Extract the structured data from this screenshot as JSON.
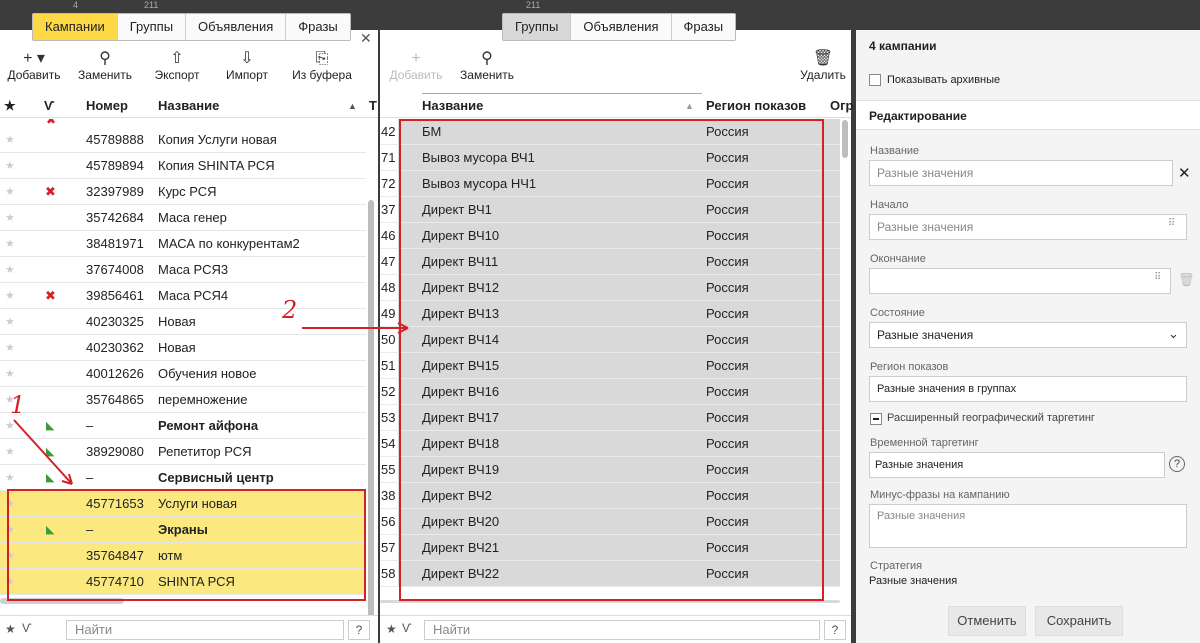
{
  "left": {
    "tab_counts": [
      "4",
      "211"
    ],
    "tabs": [
      "Кампании",
      "Группы",
      "Объявления",
      "Фразы"
    ],
    "toolbar": [
      {
        "icon": "plus-icon",
        "label": "Добавить"
      },
      {
        "icon": "search-icon",
        "label": "Заменить"
      },
      {
        "icon": "export-icon",
        "label": "Экспорт"
      },
      {
        "icon": "import-icon",
        "label": "Импорт"
      },
      {
        "icon": "clipboard-icon",
        "label": "Из буфера"
      }
    ],
    "columns": {
      "star": "★",
      "status": "Ѵ",
      "number": "Номер",
      "name": "Название",
      "more": "Т"
    },
    "rows": [
      {
        "number": "45789888",
        "name": "Копия Услуги новая",
        "status": "",
        "bold": false,
        "hl": false
      },
      {
        "number": "45789894",
        "name": "Копия SHINTA РСЯ",
        "status": "",
        "bold": false,
        "hl": false
      },
      {
        "number": "32397989",
        "name": "Курс РСЯ",
        "status": "error",
        "bold": false,
        "hl": false
      },
      {
        "number": "35742684",
        "name": "Маса генер",
        "status": "",
        "bold": false,
        "hl": false
      },
      {
        "number": "38481971",
        "name": "МАСА по конкурентам2",
        "status": "",
        "bold": false,
        "hl": false
      },
      {
        "number": "37674008",
        "name": "Маса РСЯ3",
        "status": "",
        "bold": false,
        "hl": false
      },
      {
        "number": "39856461",
        "name": "Маса РСЯ4",
        "status": "error",
        "bold": false,
        "hl": false
      },
      {
        "number": "40230325",
        "name": "Новая",
        "status": "",
        "bold": false,
        "hl": false
      },
      {
        "number": "40230362",
        "name": "Новая",
        "status": "",
        "bold": false,
        "hl": false
      },
      {
        "number": "40012626",
        "name": "Обучения новое",
        "status": "",
        "bold": false,
        "hl": false
      },
      {
        "number": "35764865",
        "name": "перемножение",
        "status": "",
        "bold": false,
        "hl": false
      },
      {
        "number": "–",
        "name": "Ремонт айфона",
        "status": "green",
        "bold": true,
        "hl": false
      },
      {
        "number": "38929080",
        "name": "Репетитор РСЯ",
        "status": "green",
        "bold": false,
        "hl": false
      },
      {
        "number": "–",
        "name": "Сервисный центр",
        "status": "green",
        "bold": true,
        "hl": false
      },
      {
        "number": "45771653",
        "name": "Услуги новая",
        "status": "",
        "bold": false,
        "hl": true
      },
      {
        "number": "–",
        "name": "Экраны",
        "status": "green",
        "bold": true,
        "hl": true
      },
      {
        "number": "35764847",
        "name": "ютм",
        "status": "",
        "bold": false,
        "hl": true
      },
      {
        "number": "45774710",
        "name": "SHINTA РСЯ",
        "status": "",
        "bold": false,
        "hl": true
      }
    ],
    "search_placeholder": "Найти",
    "help": "?"
  },
  "middle": {
    "tab_count": "211",
    "tabs": [
      "Группы",
      "Объявления",
      "Фразы"
    ],
    "toolbar": [
      {
        "icon": "plus-icon",
        "label": "Добавить"
      },
      {
        "icon": "search-icon",
        "label": "Заменить"
      },
      {
        "icon": "trash-icon",
        "label": "Удалить"
      }
    ],
    "columns": {
      "name": "Название",
      "region": "Регион показов",
      "more": "Огр"
    },
    "rows": [
      {
        "id": "42",
        "name": "БМ",
        "region": "Россия"
      },
      {
        "id": "71",
        "name": "Вывоз мусора ВЧ1",
        "region": "Россия"
      },
      {
        "id": "72",
        "name": "Вывоз мусора НЧ1",
        "region": "Россия"
      },
      {
        "id": "37",
        "name": "Директ ВЧ1",
        "region": "Россия"
      },
      {
        "id": "46",
        "name": "Директ ВЧ10",
        "region": "Россия"
      },
      {
        "id": "47",
        "name": "Директ ВЧ11",
        "region": "Россия"
      },
      {
        "id": "48",
        "name": "Директ ВЧ12",
        "region": "Россия"
      },
      {
        "id": "49",
        "name": "Директ ВЧ13",
        "region": "Россия"
      },
      {
        "id": "50",
        "name": "Директ ВЧ14",
        "region": "Россия"
      },
      {
        "id": "51",
        "name": "Директ ВЧ15",
        "region": "Россия"
      },
      {
        "id": "52",
        "name": "Директ ВЧ16",
        "region": "Россия"
      },
      {
        "id": "53",
        "name": "Директ ВЧ17",
        "region": "Россия"
      },
      {
        "id": "54",
        "name": "Директ ВЧ18",
        "region": "Россия"
      },
      {
        "id": "55",
        "name": "Директ ВЧ19",
        "region": "Россия"
      },
      {
        "id": "38",
        "name": "Директ ВЧ2",
        "region": "Россия"
      },
      {
        "id": "56",
        "name": "Директ ВЧ20",
        "region": "Россия"
      },
      {
        "id": "57",
        "name": "Директ ВЧ21",
        "region": "Россия"
      },
      {
        "id": "58",
        "name": "Директ ВЧ22",
        "region": "Россия"
      }
    ],
    "search_placeholder": "Найти",
    "help": "?"
  },
  "right": {
    "title": "4 кампании",
    "show_archived": "Показывать архивные",
    "section": "Редактирование",
    "name_label": "Название",
    "name_placeholder": "Разные значения",
    "start_label": "Начало",
    "start_placeholder": "Разные значения",
    "end_label": "Окончание",
    "state_label": "Состояние",
    "state_value": "Разные значения",
    "region_label": "Регион показов",
    "region_value": "Разные значения в группах",
    "geo_label": "Расширенный географический таргетинг",
    "time_label": "Временной таргетинг",
    "time_value": "Разные значения",
    "minus_label": "Минус-фразы на кампанию",
    "minus_placeholder": "Разные значения",
    "strategy_label": "Стратегия",
    "strategy_value": "Разные значения",
    "cancel": "Отменить",
    "save": "Сохранить",
    "help": "?"
  },
  "annotations": {
    "one": "1",
    "two": "2"
  },
  "colors": {
    "highlight": "#fbe87e",
    "selected": "#d9d9d9",
    "red": "#d42027",
    "tab_yellow": "#ffd846"
  }
}
